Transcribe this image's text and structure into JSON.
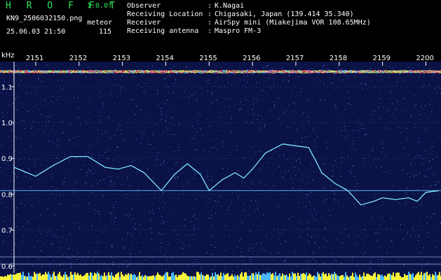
{
  "header": {
    "app_name": "H R O F F T",
    "version": "1.0.0f",
    "filename": "KN9_2506032150.png",
    "mode": "meteor",
    "datetime": "25.06.03 21:50",
    "count": "115"
  },
  "info": [
    {
      "key": "Observer",
      "value": "K.Nagai"
    },
    {
      "key": "Receiving Location",
      "value": "Chigasaki, Japan (139.414 35.340)"
    },
    {
      "key": "Receiver",
      "value": "AirSpy mini (Miakejima VOR 108.65MHz)"
    },
    {
      "key": "Receiving antenna",
      "value": "Maspro FM-3"
    }
  ],
  "chart_data": {
    "type": "spectrogram",
    "ylabel": "kHz",
    "x_ticks": [
      "2151",
      "2152",
      "2153",
      "2154",
      "2155",
      "2156",
      "2157",
      "2158",
      "2159",
      "2200"
    ],
    "y_ticks": [
      "1.1",
      "1.0",
      "0.9",
      "0.8",
      "0.7",
      "0.6"
    ],
    "ylim": [
      0.58,
      1.17
    ],
    "xlim": [
      2150.5,
      2200.3
    ],
    "background_color": "#0a1246",
    "trace_color": "#7fe6ff",
    "carrier_line_y": 0.81,
    "trace": {
      "x": [
        2150.5,
        2151.0,
        2151.4,
        2151.8,
        2152.2,
        2152.6,
        2152.9,
        2153.2,
        2153.5,
        2153.9,
        2154.2,
        2154.5,
        2154.8,
        2155.0,
        2155.3,
        2155.6,
        2155.8,
        2156.0,
        2156.3,
        2156.7,
        2157.0,
        2157.3,
        2157.6,
        2157.9,
        2158.2,
        2158.5,
        2158.8,
        2159.0,
        2159.3,
        2159.6,
        2159.8,
        2200.0,
        2200.3
      ],
      "y": [
        0.875,
        0.85,
        0.88,
        0.905,
        0.905,
        0.875,
        0.87,
        0.88,
        0.86,
        0.81,
        0.855,
        0.885,
        0.855,
        0.81,
        0.84,
        0.86,
        0.845,
        0.87,
        0.915,
        0.94,
        0.935,
        0.93,
        0.86,
        0.83,
        0.81,
        0.77,
        0.78,
        0.79,
        0.785,
        0.79,
        0.78,
        0.805,
        0.81
      ]
    }
  }
}
